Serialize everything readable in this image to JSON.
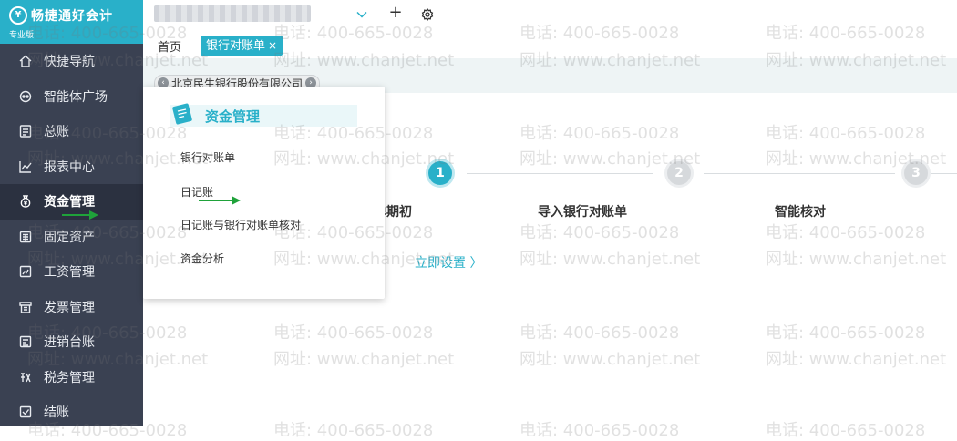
{
  "brand": {
    "name": "畅捷通好会计",
    "edition": "专业版",
    "logo_glyph": "¥",
    "color": "#29b0c9"
  },
  "sidebar": {
    "items": [
      {
        "label": "快捷导航",
        "icon": "home-icon"
      },
      {
        "label": "智能体广场",
        "icon": "robot-icon"
      },
      {
        "label": "总账",
        "icon": "ledger-icon"
      },
      {
        "label": "报表中心",
        "icon": "chart-icon"
      },
      {
        "label": "资金管理",
        "icon": "money-bag-icon",
        "active": true
      },
      {
        "label": "固定资产",
        "icon": "building-icon"
      },
      {
        "label": "工资管理",
        "icon": "salary-icon"
      },
      {
        "label": "发票管理",
        "icon": "invoice-icon"
      },
      {
        "label": "进销台账",
        "icon": "book-icon"
      },
      {
        "label": "税务管理",
        "icon": "tax-icon"
      },
      {
        "label": "结账",
        "icon": "checkout-icon"
      }
    ]
  },
  "topbar": {
    "plus_glyph": "+"
  },
  "tabs": {
    "home": "首页",
    "active": "银行对账单",
    "close_glyph": "×"
  },
  "subheader": {
    "bank_name": "北京民生银行股份有限公司",
    "prev_glyph": "‹",
    "next_glyph": "›"
  },
  "dropdown": {
    "title": "资金管理",
    "items": [
      "银行对账单",
      "日记账",
      "日记账与银行对账单核对",
      "资金分析"
    ]
  },
  "steps": [
    {
      "number": "1",
      "label": "单期初",
      "state": "active"
    },
    {
      "number": "2",
      "label": "导入银行对账单",
      "state": "inactive"
    },
    {
      "number": "3",
      "label": "智能核对",
      "state": "inactive"
    }
  ],
  "setup_link": "立即设置 〉",
  "watermark": {
    "phone": "电话: 400-665-0028",
    "site": "网址: www.chanjet.net"
  },
  "colors": {
    "accent": "#29b0c9",
    "sidebar_bg": "#3a4152",
    "sidebar_active_bg": "#2b3140",
    "arrow_green": "#1fa23a"
  }
}
